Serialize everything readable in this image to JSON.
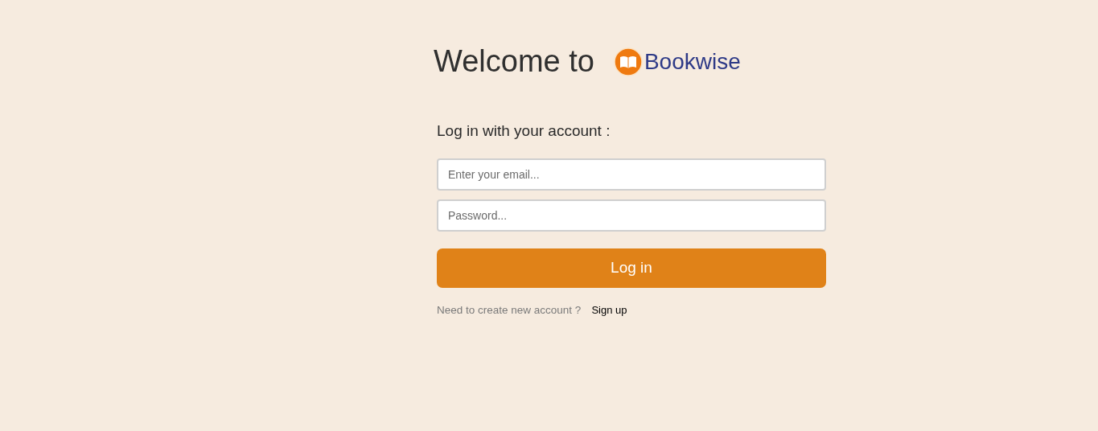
{
  "header": {
    "title": "Welcome to",
    "brand": "Bookwise"
  },
  "form": {
    "heading": "Log in with your account :",
    "email": {
      "placeholder": "Enter your email..."
    },
    "password": {
      "placeholder": "Password..."
    },
    "submit": "Log in",
    "signup_prompt": "Need to create new account ?",
    "signup_link": "Sign up"
  }
}
